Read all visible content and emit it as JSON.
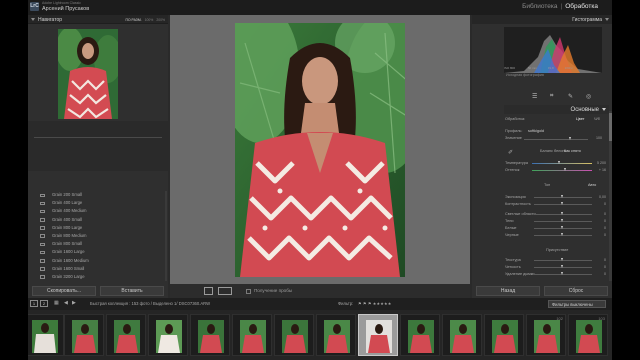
{
  "app": {
    "logo": "LrC",
    "product": "Adobe Lightroom Classic",
    "user": "Арсений Прусаков",
    "modules": [
      "Библиотека",
      "Обработка"
    ],
    "active_module": "Обработка"
  },
  "navigator": {
    "title": "Навигатор",
    "zoom_options": [
      "ПО РАЗМ.",
      "100%",
      "200%"
    ]
  },
  "presets": {
    "items": [
      "Grain 200 Small",
      "Grain 400 Large",
      "Grain 400 Medium",
      "Grain 400 Small",
      "Grain 800 Large",
      "Grain 800 Medium",
      "Grain 800 Small",
      "Grain 1600 Large",
      "Grain 1600 Medium",
      "Grain 1600 Small",
      "Grain 3200 Large"
    ],
    "copy_label": "Скопировать...",
    "paste_label": "Вставить"
  },
  "toolbar": {
    "soft_proof_label": "Получение пробы"
  },
  "histogram": {
    "title": "Гистограмма",
    "iso": "ISO 800",
    "focal": "50 mm",
    "aperture": "f/1,8",
    "shutter": "1/60 с",
    "original_photo_label": "Исходная фотография"
  },
  "basic": {
    "title": "Основные",
    "treatment_label": "Обработка:",
    "treatment_color": "Цвет",
    "treatment_bw": "Ч/б",
    "profile_label": "Профиль:",
    "profile_value": "softkigold",
    "amount_label": "Значение",
    "amount_value": "100",
    "wb_label": "Баланс белого:",
    "wb_value": "Как снято",
    "temp_label": "Температура",
    "temp_value": "5 200",
    "tint_label": "Оттенок",
    "tint_value": "+ 16",
    "tone_label": "Тон",
    "tone_auto": "Авто",
    "exposure_label": "Экспозиция",
    "exposure_value": "0,00",
    "contrast_label": "Контрастность",
    "contrast_value": "0",
    "highlights_label": "Светлые области",
    "highlights_value": "0",
    "shadows_label": "Тени",
    "shadows_value": "0",
    "whites_label": "Белые",
    "whites_value": "0",
    "blacks_label": "Черные",
    "blacks_value": "0",
    "presence_label": "Присутствие",
    "texture_label": "Текстура",
    "texture_value": "0",
    "clarity_label": "Четкость",
    "clarity_value": "0",
    "dehaze_label": "Удаление дымки",
    "dehaze_value": "0"
  },
  "right_buttons": {
    "previous_label": "Назад",
    "reset_label": "Сброс"
  },
  "filmbar": {
    "page1": "1",
    "page2": "2",
    "path": "Быстрая коллекция : 153 фото / Выделено 1/ DSC07360.ARW",
    "filter_label": "Фильтр:",
    "filter_off": "Фильтры выключены"
  },
  "filmstrip": {
    "frame_numbers": [
      "102",
      "103"
    ]
  },
  "colors": {
    "accent_selected_frame": "#9b9b9b",
    "panel_bg": "#2f2f2f",
    "image_bg": "#6b6b6b"
  }
}
